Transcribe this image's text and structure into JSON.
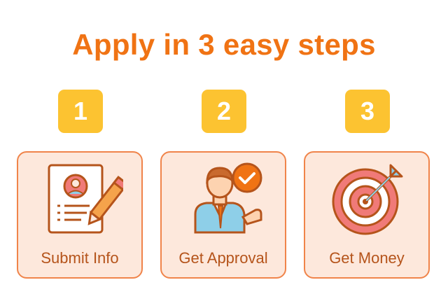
{
  "title": "Apply in 3 easy steps",
  "colors": {
    "title": "#f07314",
    "badge": "#fcc331",
    "card_bg": "#fde8dc",
    "card_border": "#f0844a",
    "label": "#b5541b"
  },
  "steps": [
    {
      "number": "1",
      "label": "Submit Info",
      "icon": "document-pencil-icon"
    },
    {
      "number": "2",
      "label": "Get Approval",
      "icon": "person-checkmark-icon"
    },
    {
      "number": "3",
      "label": "Get Money",
      "icon": "target-dart-icon"
    }
  ]
}
